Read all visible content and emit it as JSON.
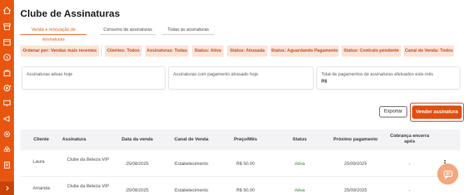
{
  "app": {
    "page_title": "Clube de Assinaturas"
  },
  "tabs": [
    {
      "label": "Venda e renovação de assinaturas",
      "active": true
    },
    {
      "label": "Consumo de assinaturas",
      "active": false
    },
    {
      "label": "Todas as assinaturas",
      "active": false
    }
  ],
  "filters": {
    "sort_label": "Ordenar por: Vendas mais recentes",
    "chips": [
      "Clientes: Todos",
      "Assinaturas: Todas",
      "Status: Ativa",
      "Status: Atrasada",
      "Status: Aguardando Pagamento",
      "Status: Contrato pendente",
      "Canal de Venda: Todos"
    ]
  },
  "cards": [
    {
      "label": "Assinaturas ativas hoje",
      "value": ""
    },
    {
      "label": "Assinaturas com pagamento atrasado hoje",
      "value": ""
    },
    {
      "label": "Total de pagamentos de assinaturas efetuados este mês",
      "value": "R$"
    }
  ],
  "actions": {
    "export_label": "Exportar",
    "sell_label": "Vender assinatura"
  },
  "table": {
    "columns": [
      "Cliente",
      "Assinatura",
      "Data da venda",
      "Canal de Venda",
      "Preço/Mês",
      "Status",
      "Próximo pagamento",
      "Cobrança encerra após"
    ],
    "rows": [
      {
        "cliente": "Laura",
        "assinatura": "Clube da Beleza VIP",
        "data": "25/08/2025",
        "canal": "Estabelecimento",
        "preco": "R$ 50,00",
        "status": "Ativa",
        "proximo": "25/09/2025",
        "encerra": "-"
      },
      {
        "cliente": "Amanda",
        "assinatura": "Clube da Beleza VIP",
        "data": "25/08/2025",
        "canal": "Estabelecimento",
        "preco": "R$ 50,00",
        "status": "Ativa",
        "proximo": "25/09/2025",
        "encerra": "-"
      }
    ]
  },
  "colors": {
    "brand": "#e8550f",
    "chip_bg": "#fbe3d8",
    "status_active": "#2a7a2a"
  },
  "icons": [
    "home-icon",
    "storefront-icon",
    "calendar-icon",
    "cash-icon",
    "shopping-bag-icon",
    "settings-badge-icon",
    "presentation-icon",
    "megaphone-icon",
    "gear-icon",
    "flower-icon",
    "clipboard-icon",
    "chevron-right-icon",
    "chat-icon",
    "kebab-menu-icon"
  ]
}
